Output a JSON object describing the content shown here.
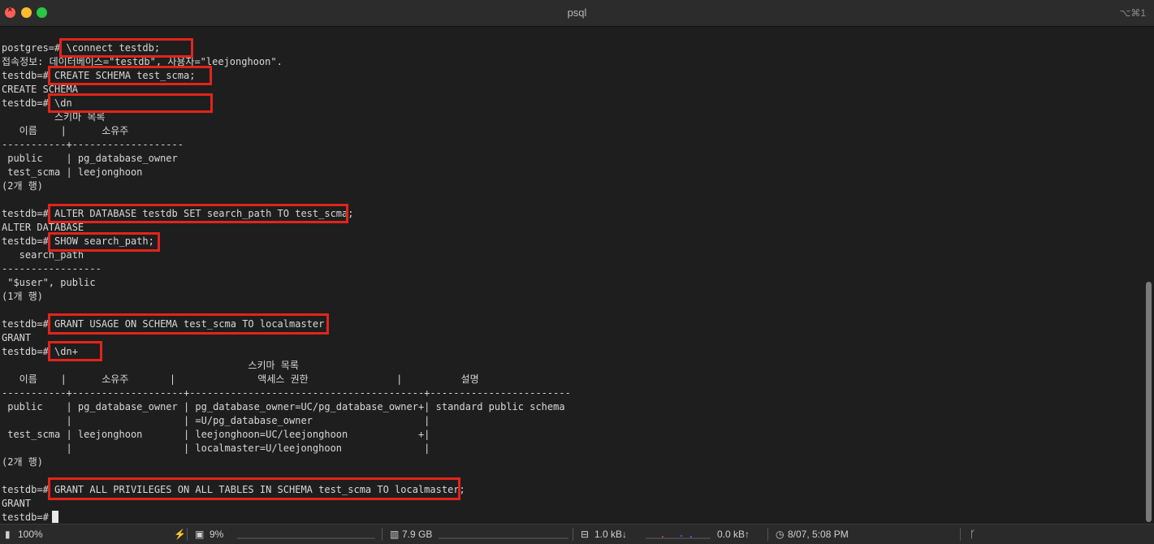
{
  "window": {
    "title": "psql",
    "shortcut": "⌥⌘1"
  },
  "terminal": {
    "lines": [
      "postgres=# \\connect testdb;",
      "접속정보: 데이터베이스=\"testdb\", 사용자=\"leejonghoon\".",
      "testdb=# CREATE SCHEMA test_scma;",
      "CREATE SCHEMA",
      "testdb=# \\dn",
      "         스키마 목록",
      "   이름    |      소유주",
      "-----------+-------------------",
      " public    | pg_database_owner",
      " test_scma | leejonghoon",
      "(2개 행)",
      "",
      "testdb=# ALTER DATABASE testdb SET search_path TO test_scma;",
      "ALTER DATABASE",
      "testdb=# SHOW search_path;",
      "   search_path",
      "-----------------",
      " \"$user\", public",
      "(1개 행)",
      "",
      "testdb=# GRANT USAGE ON SCHEMA test_scma TO localmaster;",
      "GRANT",
      "testdb=# \\dn+",
      "                                          스키마 목록",
      "   이름    |      소유주       |              액세스 권한               |          설명",
      "-----------+-------------------+----------------------------------------+------------------------",
      " public    | pg_database_owner | pg_database_owner=UC/pg_database_owner+| standard public schema",
      "           |                   | =U/pg_database_owner                   |",
      " test_scma | leejonghoon       | leejonghoon=UC/leejonghoon            +|",
      "           |                   | localmaster=U/leejonghoon              |",
      "(2개 행)",
      "",
      "testdb=# GRANT ALL PRIVILEGES ON ALL TABLES IN SCHEMA test_scma TO localmaster;",
      "GRANT",
      "testdb=# "
    ]
  },
  "statusbar": {
    "battery": "100%",
    "cpu": "9%",
    "memory": "7.9 GB",
    "net_down": "1.0 kB↓",
    "net_up": "0.0 kB↑",
    "datetime": "8/07, 5:08 PM"
  },
  "colors": {
    "highlight": "#e3241b",
    "background": "#1e1e1e",
    "text": "#d8d8d8"
  }
}
